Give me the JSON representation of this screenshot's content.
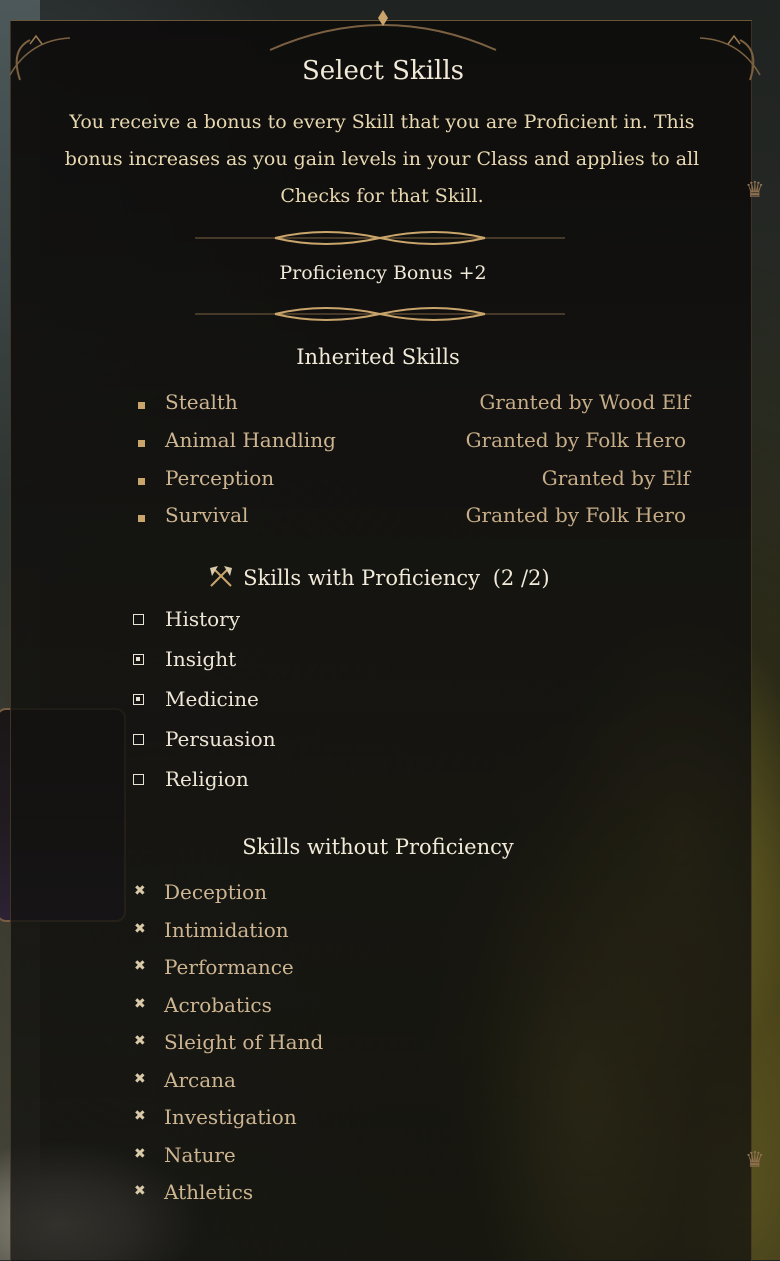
{
  "header": {
    "title": "Select Skills",
    "description": "You receive a bonus to every Skill that you are Proficient in. This bonus increases as you gain levels in your Class and applies to all Checks for that Skill.",
    "proficiency_bonus": "Proficiency Bonus  +2"
  },
  "inherited": {
    "heading": "Inherited Skills",
    "items": [
      {
        "skill": "Stealth",
        "source": "Granted by Wood Elf"
      },
      {
        "skill": "Animal Handling",
        "source": "Granted by Folk Hero"
      },
      {
        "skill": "Perception",
        "source": "Granted by Elf"
      },
      {
        "skill": "Survival",
        "source": "Granted by Folk Hero"
      }
    ]
  },
  "proficient": {
    "heading": "Skills with Proficiency",
    "count": "(2 /2)",
    "icon": "crossed-axes-icon",
    "items": [
      {
        "skill": "History",
        "selected": false
      },
      {
        "skill": "Insight",
        "selected": true
      },
      {
        "skill": "Medicine",
        "selected": true
      },
      {
        "skill": "Persuasion",
        "selected": false
      },
      {
        "skill": "Religion",
        "selected": false
      }
    ]
  },
  "non_proficient": {
    "heading": "Skills without Proficiency",
    "items": [
      "Deception",
      "Intimidation",
      "Performance",
      "Acrobatics",
      "Sleight of Hand",
      "Arcana",
      "Investigation",
      "Nature",
      "Athletics"
    ]
  },
  "colors": {
    "gold_accent": "#c9a56b",
    "frame": "#6b5538",
    "title_text": "#f1ead8",
    "body_text": "#e8d8b0"
  }
}
